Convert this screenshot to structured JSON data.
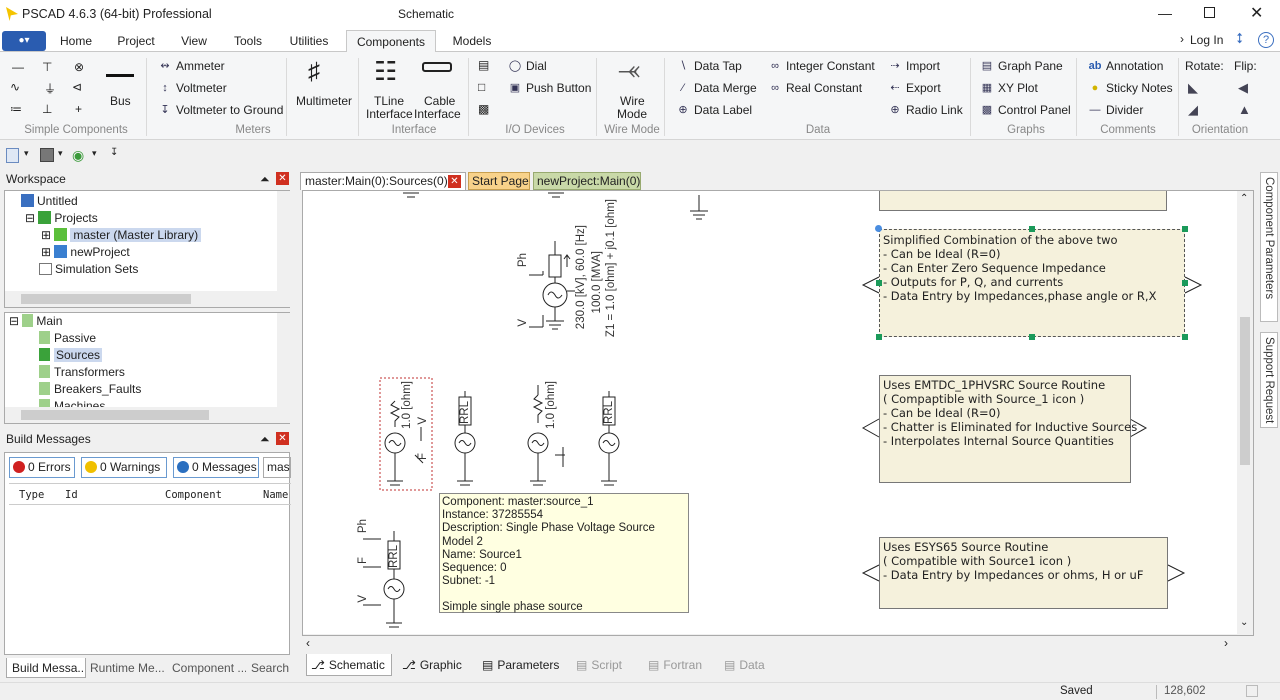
{
  "window": {
    "title": "PSCAD 4.6.3 (64-bit) Professional",
    "context_title": "Schematic"
  },
  "ribbon_tabs": [
    "Home",
    "Project",
    "View",
    "Tools",
    "Utilities",
    "Components",
    "Models"
  ],
  "login": "Log In",
  "ribbon": {
    "groups": [
      "Simple Components",
      "Meters",
      "Interface",
      "I/O Devices",
      "Wire Mode",
      "Data",
      "Graphs",
      "Comments",
      "Orientation"
    ],
    "bus": "Bus",
    "meters": [
      "Ammeter",
      "Voltmeter",
      "Voltmeter to Ground"
    ],
    "multimeter": "Multimeter",
    "tline": [
      "TLine",
      "Interface"
    ],
    "cable": [
      "Cable",
      "Interface"
    ],
    "io": [
      "Dial",
      "Push Button"
    ],
    "wire": [
      "Wire",
      "Mode"
    ],
    "data_col1": [
      "Data Tap",
      "Data Merge",
      "Data Label"
    ],
    "data_col2": [
      "Integer Constant",
      "Real Constant"
    ],
    "data_col3": [
      "Import",
      "Export",
      "Radio Link"
    ],
    "graphs": [
      "Graph Pane",
      "XY Plot",
      "Control Panel"
    ],
    "comments": [
      "Annotation",
      "Sticky Notes",
      "Divider"
    ],
    "rotate": "Rotate:",
    "flip": "Flip:"
  },
  "workspace": {
    "title": "Workspace",
    "tree": [
      "Untitled",
      "Projects",
      "master (Master Library)",
      "newProject",
      "Simulation Sets"
    ],
    "tree2": [
      "Main",
      "Passive",
      "Sources",
      "Transformers",
      "Breakers_Faults",
      "Machines"
    ]
  },
  "build": {
    "title": "Build Messages",
    "filters": [
      "0 Errors",
      "0 Warnings",
      "0 Messages"
    ],
    "search_value": "mast",
    "columns": [
      "Type",
      "Id",
      "Component",
      "Name"
    ],
    "bottom_tabs": [
      "Build Messa...",
      "Runtime Me...",
      "Component ...",
      "Search"
    ]
  },
  "doc_tabs": [
    "master:Main(0):Sources(0)",
    "Start Page",
    "newProject:Main(0)"
  ],
  "schematic": {
    "src_labels": [
      "230.0 [kV], 60.0 [Hz]",
      "100.0 [MVA]",
      "Z1 = 1.0 [ohm] + j0.1 [ohm]"
    ],
    "pins": [
      "Ph",
      "V",
      "F"
    ],
    "ohm": "1.0 [ohm]",
    "rrl": "RRL",
    "note1": [
      "Simplified Combination of the above two",
      " - Can be Ideal (R=0)",
      " - Can Enter Zero Sequence Impedance",
      " - Outputs for P, Q, and currents",
      " - Data Entry by Impedances,phase angle or R,X"
    ],
    "note2": [
      "Uses EMTDC_1PHVSRC Source Routine",
      "( Compaptible with Source_1 icon )",
      " - Can be Ideal (R=0)",
      " - Chatter is Eliminated for Inductive Sources",
      " - Interpolates Internal Source Quantities"
    ],
    "note3": [
      "Uses ESYS65 Source Routine",
      "( Compatible with Source1 icon )",
      " - Data Entry by Impedances or ohms, H or uF"
    ],
    "tooltip": [
      "Component: master:source_1",
      "Instance: 37285554",
      "Description: Single Phase Voltage Source Model 2",
      "Name: Source1",
      "Sequence: 0",
      "Subnet: -1",
      "",
      "Simple single phase source"
    ]
  },
  "bottom_tabs": [
    "Schematic",
    "Graphic",
    "Parameters",
    "Script",
    "Fortran",
    "Data"
  ],
  "side_tabs": [
    "Component Parameters",
    "Support Request"
  ],
  "status": {
    "state": "Saved",
    "coords": "128,602"
  }
}
